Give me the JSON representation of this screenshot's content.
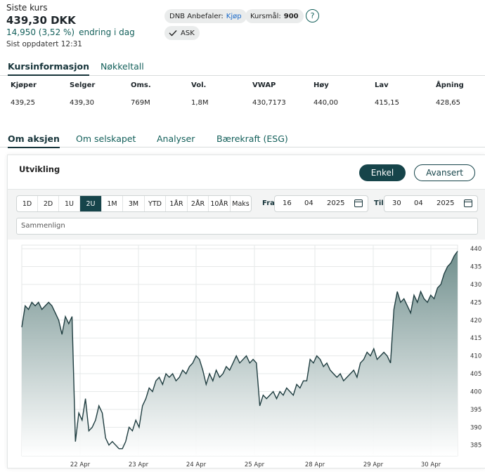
{
  "quote": {
    "label": "Siste kurs",
    "price": "439,30 DKK",
    "change": "14,950  (3,52 %)",
    "change_text": "endring i dag",
    "updated": "Sist oppdatert 12:31"
  },
  "badges": {
    "dnb_label": "DNB Anbefaler:",
    "dnb_value": "Kjøp",
    "target_label": "Kursmål:",
    "target_value": "900",
    "ask": "ASK",
    "help": "?"
  },
  "tabs_top": [
    "Kursinformasjon",
    "Nøkkeltall"
  ],
  "info": {
    "headers": [
      "Kjøper",
      "Selger",
      "Oms.",
      "Vol.",
      "VWAP",
      "Høy",
      "Lav",
      "Åpning"
    ],
    "values": [
      "439,25",
      "439,30",
      "769M",
      "1,8M",
      "430,7173",
      "440,00",
      "415,15",
      "428,65"
    ]
  },
  "tabs_main": [
    "Om aksjen",
    "Om selskapet",
    "Analyser",
    "Bærekraft (ESG)"
  ],
  "card": {
    "title": "Utvikling",
    "btn_simple": "Enkel",
    "btn_advanced": "Avansert"
  },
  "periods": [
    "1D",
    "2D",
    "1U",
    "2U",
    "1M",
    "3M",
    "YTD",
    "1ÅR",
    "2ÅR",
    "10ÅR",
    "Maks"
  ],
  "active_period": "2U",
  "dates": {
    "from_label": "Fra",
    "from": [
      "16",
      "04",
      "2025"
    ],
    "to_label": "Til",
    "to": [
      "30",
      "04",
      "2025"
    ]
  },
  "compare_placeholder": "Sammenlign",
  "colors": {
    "primary": "#16444a",
    "accent_text": "#14605b",
    "line": "#1f3d40",
    "area_top": "#6f8e8c",
    "area_bottom": "#ffffff"
  },
  "chart_data": {
    "type": "area",
    "x_ticks": [
      "22 Apr",
      "23 Apr",
      "24 Apr",
      "25 Apr",
      "28 Apr",
      "29 Apr",
      "30 Apr"
    ],
    "y_ticks": [
      385,
      390,
      395,
      400,
      405,
      410,
      415,
      420,
      425,
      430,
      435,
      440
    ],
    "ylim": [
      382,
      441
    ],
    "grid": true,
    "y_axis_side": "right",
    "series": [
      {
        "values": [
          418,
          424,
          423,
          425,
          424,
          425,
          423,
          424,
          425,
          424,
          422,
          420,
          416,
          421,
          419,
          421,
          386,
          394,
          392,
          398,
          389,
          390,
          392,
          396,
          394,
          387,
          385,
          386,
          385,
          384,
          384,
          386,
          390,
          389,
          392,
          390,
          396,
          398,
          401,
          400,
          403,
          404,
          402,
          405,
          404,
          405,
          403,
          404,
          406,
          405,
          407,
          408,
          410,
          409,
          406,
          402,
          405,
          403,
          406,
          404,
          405,
          407,
          406,
          408,
          410,
          408,
          409,
          410,
          408,
          409,
          408,
          396,
          399,
          398,
          399,
          400,
          398,
          400,
          399,
          401,
          400,
          399,
          402,
          401,
          403,
          403,
          409,
          408,
          410,
          409,
          407,
          408,
          406,
          405,
          404,
          405,
          403,
          404,
          405,
          406,
          404,
          408,
          409,
          411,
          410,
          412,
          409,
          410,
          411,
          410,
          408,
          423,
          428,
          425,
          426,
          424,
          422,
          427,
          425,
          428,
          426,
          425,
          427,
          426,
          429,
          430,
          433,
          435,
          436,
          438,
          439.3
        ]
      }
    ]
  }
}
